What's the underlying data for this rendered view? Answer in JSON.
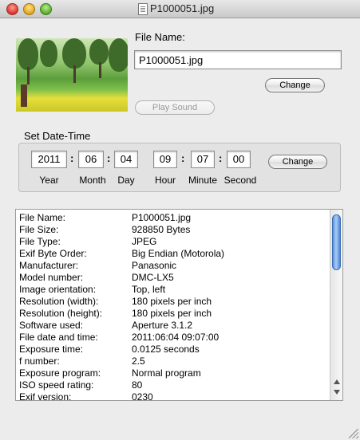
{
  "window": {
    "title": "P1000051.jpg"
  },
  "file": {
    "label": "File Name:",
    "value": "P1000051.jpg",
    "change_label": "Change",
    "play_sound_label": "Play Sound"
  },
  "datetime": {
    "group_label": "Set Date-Time",
    "fields": [
      {
        "value": "2011",
        "caption": "Year"
      },
      {
        "value": "06",
        "caption": "Month"
      },
      {
        "value": "04",
        "caption": "Day"
      },
      {
        "value": "09",
        "caption": "Hour"
      },
      {
        "value": "07",
        "caption": "Minute"
      },
      {
        "value": "00",
        "caption": "Second"
      }
    ],
    "separator": ":",
    "change_label": "Change"
  },
  "exif": [
    {
      "key": "File Name:",
      "value": "P1000051.jpg"
    },
    {
      "key": "File Size:",
      "value": "928850 Bytes"
    },
    {
      "key": "File Type:",
      "value": "JPEG"
    },
    {
      "key": "Exif Byte Order:",
      "value": "Big Endian (Motorola)"
    },
    {
      "key": "Manufacturer:",
      "value": "Panasonic"
    },
    {
      "key": "Model number:",
      "value": "DMC-LX5"
    },
    {
      "key": "Image orientation:",
      "value": "Top, left"
    },
    {
      "key": "Resolution (width):",
      "value": "180 pixels per inch"
    },
    {
      "key": "Resolution (height):",
      "value": "180 pixels per inch"
    },
    {
      "key": "Software used:",
      "value": "Aperture 3.1.2"
    },
    {
      "key": "File date and time:",
      "value": "2011:06:04 09:07:00"
    },
    {
      "key": "Exposure time:",
      "value": "0.0125 seconds"
    },
    {
      "key": "f number:",
      "value": "2.5"
    },
    {
      "key": "Exposure program:",
      "value": "Normal program"
    },
    {
      "key": "ISO speed rating:",
      "value": "80"
    },
    {
      "key": "Exif version:",
      "value": "0230"
    }
  ],
  "scrollbar": {
    "position_fraction": 0.0
  }
}
